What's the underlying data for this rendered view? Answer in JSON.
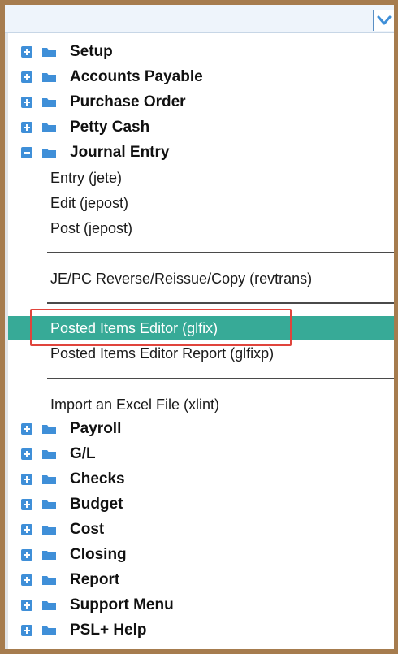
{
  "colors": {
    "frame": "#a67c4e",
    "accent_icon": "#3f8fd8",
    "selected_bg": "#37aa97",
    "selection_box": "#e0443c"
  },
  "menu": {
    "top_folders": [
      {
        "label": "Setup",
        "icon": "plus"
      },
      {
        "label": "Accounts Payable",
        "icon": "plus"
      },
      {
        "label": "Purchase Order",
        "icon": "plus"
      },
      {
        "label": "Petty Cash",
        "icon": "plus"
      }
    ],
    "journal_entry": {
      "label": "Journal Entry",
      "icon": "minus",
      "items": [
        {
          "label": "Entry (jete)"
        },
        {
          "label": "Edit (jepost)"
        },
        {
          "label": "Post (jepost)"
        },
        {
          "label": "JE/PC Reverse/Reissue/Copy (revtrans)"
        },
        {
          "label": "Posted Items Editor (glfix)",
          "selected": true
        },
        {
          "label": "Posted Items Editor Report (glfixp)"
        },
        {
          "label": "Import an Excel File (xlint)"
        }
      ]
    },
    "bottom_folders": [
      {
        "label": "Payroll",
        "icon": "plus"
      },
      {
        "label": "G/L",
        "icon": "plus"
      },
      {
        "label": "Checks",
        "icon": "plus"
      },
      {
        "label": "Budget",
        "icon": "plus"
      },
      {
        "label": "Cost",
        "icon": "plus"
      },
      {
        "label": "Closing",
        "icon": "plus"
      },
      {
        "label": "Report",
        "icon": "plus"
      },
      {
        "label": "Support Menu",
        "icon": "plus"
      },
      {
        "label": "PSL+ Help",
        "icon": "plus"
      }
    ]
  }
}
